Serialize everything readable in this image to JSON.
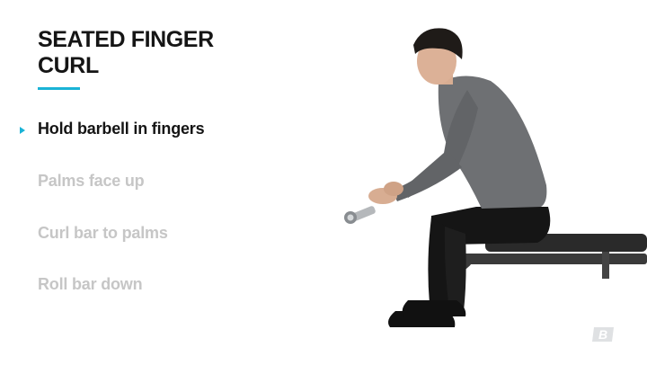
{
  "exercise": {
    "title": "SEATED FINGER CURL",
    "accent_color": "#1ab3d6"
  },
  "steps": [
    {
      "label": "Hold barbell in fingers",
      "active": true
    },
    {
      "label": "Palms face up",
      "active": false
    },
    {
      "label": "Curl bar to palms",
      "active": false
    },
    {
      "label": "Roll bar down",
      "active": false
    }
  ],
  "illustration": {
    "subject": "man seated on a flat bench holding a short barbell with fingers",
    "shirt_color": "#6e7073",
    "pants_color": "#151515",
    "bench_color": "#2a2a2a"
  },
  "brand_logo": {
    "icon": "bodybuilding-b-logo-icon"
  }
}
